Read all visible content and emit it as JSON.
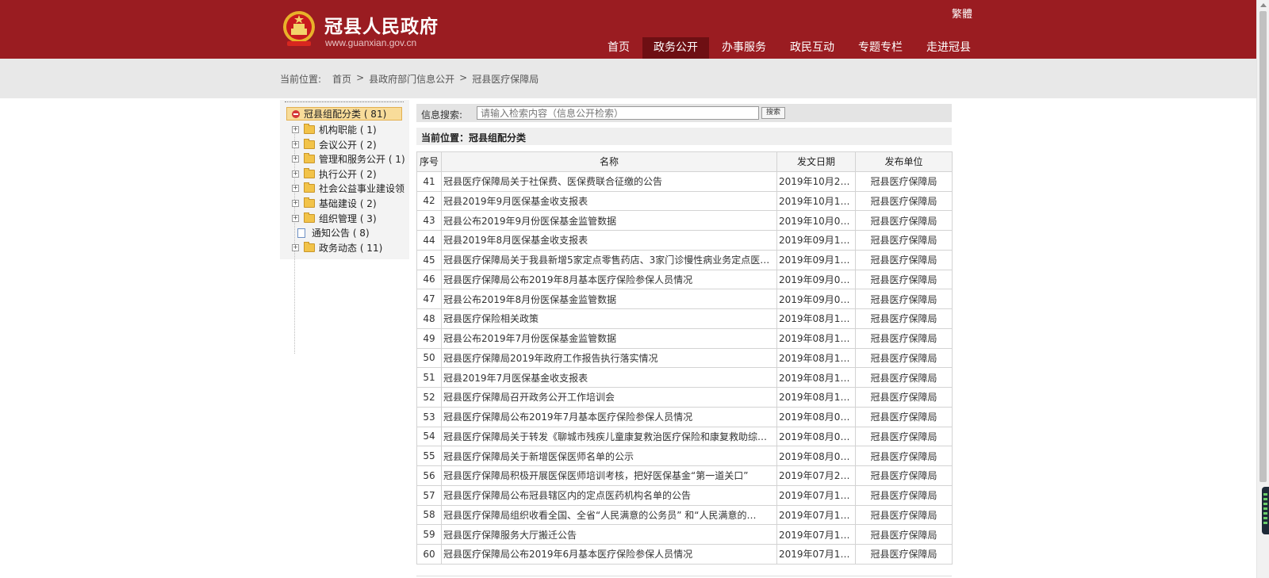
{
  "header": {
    "site_title": "冠县人民政府",
    "site_url": "www.guanxian.gov.cn",
    "lang_toggle": "繁體",
    "nav": [
      {
        "label": "首页",
        "active": false
      },
      {
        "label": "政务公开",
        "active": true
      },
      {
        "label": "办事服务",
        "active": false
      },
      {
        "label": "政民互动",
        "active": false
      },
      {
        "label": "专题专栏",
        "active": false
      },
      {
        "label": "走进冠县",
        "active": false
      }
    ],
    "brand_color": "#9a1c21"
  },
  "breadcrumb": {
    "prefix": "当前位置:",
    "items": [
      "首页",
      "县政府部门信息公开",
      "冠县医疗保障局"
    ],
    "sep": ">"
  },
  "tree": {
    "root": "冠县组配分类 ( 81)",
    "items": [
      {
        "label": "机构职能 ( 1)",
        "type": "folder"
      },
      {
        "label": "会议公开 ( 2)",
        "type": "folder"
      },
      {
        "label": "管理和服务公开 ( 1)",
        "type": "folder"
      },
      {
        "label": "执行公开 ( 2)",
        "type": "folder"
      },
      {
        "label": "社会公益事业建设领",
        "type": "folder"
      },
      {
        "label": "基础建设 ( 2)",
        "type": "folder"
      },
      {
        "label": "组织管理 ( 3)",
        "type": "folder"
      },
      {
        "label": "通知公告 ( 8)",
        "type": "doc"
      },
      {
        "label": "政务动态 ( 11)",
        "type": "folder"
      }
    ]
  },
  "search": {
    "label": "信息搜索:",
    "placeholder": "请输入检索内容（信息公开检索）",
    "button": "搜索"
  },
  "location": "当前位置：冠县组配分类",
  "table": {
    "headers": [
      "序号",
      "名称",
      "发文日期",
      "发布单位"
    ],
    "rows": [
      [
        "41",
        "冠县医疗保障局关于社保费、医保费联合征缴的公告",
        "2019年10月2…",
        "冠县医疗保障局"
      ],
      [
        "42",
        "冠县2019年9月医保基金收支报表",
        "2019年10月1…",
        "冠县医疗保障局"
      ],
      [
        "43",
        "冠县公布2019年9月份医保基金监管数据",
        "2019年10月0…",
        "冠县医疗保障局"
      ],
      [
        "44",
        "冠县2019年8月医保基金收支报表",
        "2019年09月1…",
        "冠县医疗保障局"
      ],
      [
        "45",
        "冠县医疗保障局关于我县新增5家定点零售药店、3家门诊慢性病业务定点医…",
        "2019年09月1…",
        "冠县医疗保障局"
      ],
      [
        "46",
        "冠县医疗保障局公布2019年8月基本医疗保险参保人员情况",
        "2019年09月0…",
        "冠县医疗保障局"
      ],
      [
        "47",
        "冠县公布2019年8月份医保基金监管数据",
        "2019年09月0…",
        "冠县医疗保障局"
      ],
      [
        "48",
        "冠县医疗保险相关政策",
        "2019年08月1…",
        "冠县医疗保障局"
      ],
      [
        "49",
        "冠县公布2019年7月份医保基金监管数据",
        "2019年08月1…",
        "冠县医疗保障局"
      ],
      [
        "50",
        "冠县医疗保障局2019年政府工作报告执行落实情况",
        "2019年08月1…",
        "冠县医疗保障局"
      ],
      [
        "51",
        "冠县2019年7月医保基金收支报表",
        "2019年08月1…",
        "冠县医疗保障局"
      ],
      [
        "52",
        "冠县医疗保障局召开政务公开工作培训会",
        "2019年08月1…",
        "冠县医疗保障局"
      ],
      [
        "53",
        "冠县医疗保障局公布2019年7月基本医疗保险参保人员情况",
        "2019年08月0…",
        "冠县医疗保障局"
      ],
      [
        "54",
        "冠县医疗保障局关于转发《聊城市残疾儿童康复救治医疗保险和康复救助综…",
        "2019年08月0…",
        "冠县医疗保障局"
      ],
      [
        "55",
        "冠县医疗保障局关于新增医保医师名单的公示",
        "2019年08月0…",
        "冠县医疗保障局"
      ],
      [
        "56",
        "冠县医疗保障局积极开展医保医师培训考核，把好医保基金“第一道关口”",
        "2019年07月2…",
        "冠县医疗保障局"
      ],
      [
        "57",
        "冠县医疗保障局公布冠县辖区内的定点医药机构名单的公告",
        "2019年07月1…",
        "冠县医疗保障局"
      ],
      [
        "58",
        "冠县医疗保障局组织收看全国、全省“人民满意的公务员” 和“人民满意的…",
        "2019年07月1…",
        "冠县医疗保障局"
      ],
      [
        "59",
        "冠县医疗保障服务大厅搬迁公告",
        "2019年07月1…",
        "冠县医疗保障局"
      ],
      [
        "60",
        "冠县医疗保障局公布2019年6月基本医疗保险参保人员情况",
        "2019年07月1…",
        "冠县医疗保障局"
      ]
    ]
  },
  "icons": {
    "emblem": "national-emblem-icon",
    "folder": "folder-icon",
    "doc": "document-icon",
    "expand": "plus-expand-icon"
  }
}
